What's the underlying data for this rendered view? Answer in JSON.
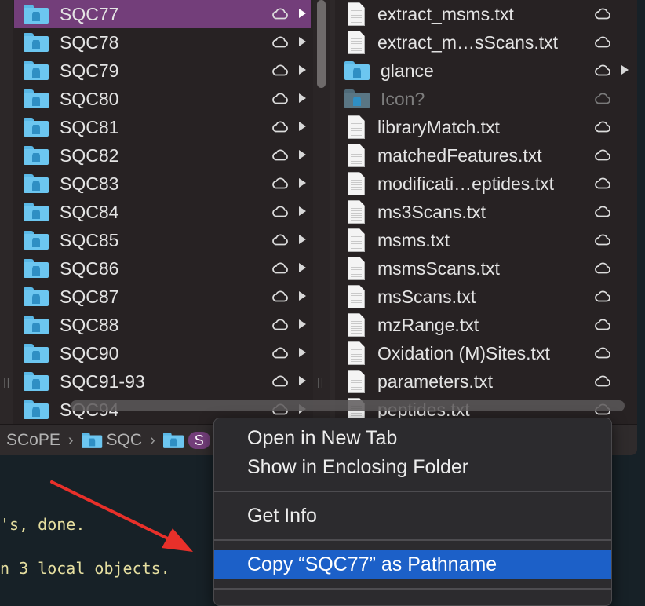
{
  "finder": {
    "left_column": [
      {
        "name": "SQC77",
        "selected": true
      },
      {
        "name": "SQC78"
      },
      {
        "name": "SQC79"
      },
      {
        "name": "SQC80"
      },
      {
        "name": "SQC81"
      },
      {
        "name": "SQC82"
      },
      {
        "name": "SQC83"
      },
      {
        "name": "SQC84"
      },
      {
        "name": "SQC85"
      },
      {
        "name": "SQC86"
      },
      {
        "name": "SQC87"
      },
      {
        "name": "SQC88"
      },
      {
        "name": "SQC90"
      },
      {
        "name": "SQC91-93"
      },
      {
        "name": "SQC94"
      }
    ],
    "right_column": [
      {
        "name": "extract_msms.txt",
        "kind": "file"
      },
      {
        "name": "extract_m…sScans.txt",
        "kind": "file"
      },
      {
        "name": "glance",
        "kind": "folder"
      },
      {
        "name": "Icon?",
        "kind": "folder-dim"
      },
      {
        "name": "libraryMatch.txt",
        "kind": "file"
      },
      {
        "name": "matchedFeatures.txt",
        "kind": "file"
      },
      {
        "name": "modificati…eptides.txt",
        "kind": "file"
      },
      {
        "name": "ms3Scans.txt",
        "kind": "file"
      },
      {
        "name": "msms.txt",
        "kind": "file"
      },
      {
        "name": "msmsScans.txt",
        "kind": "file"
      },
      {
        "name": "msScans.txt",
        "kind": "file"
      },
      {
        "name": "mzRange.txt",
        "kind": "file"
      },
      {
        "name": "Oxidation (M)Sites.txt",
        "kind": "file"
      },
      {
        "name": "parameters.txt",
        "kind": "file"
      },
      {
        "name": "peptides.txt",
        "kind": "file"
      }
    ],
    "pathbar": {
      "seg1": "SCoPE",
      "seg2": "SQC",
      "seg3": "S",
      "separator": "›"
    }
  },
  "terminal": {
    "line1": "'s, done.",
    "line2": "n 3 local objects."
  },
  "context_menu": {
    "open_new_tab": "Open in New Tab",
    "show_enclosing": "Show in Enclosing Folder",
    "get_info": "Get Info",
    "copy_pathname": "Copy “SQC77” as Pathname"
  },
  "colors": {
    "selection": "#733e7a",
    "menu_highlight": "#1c60c8",
    "annotation_arrow": "#e8302a"
  }
}
